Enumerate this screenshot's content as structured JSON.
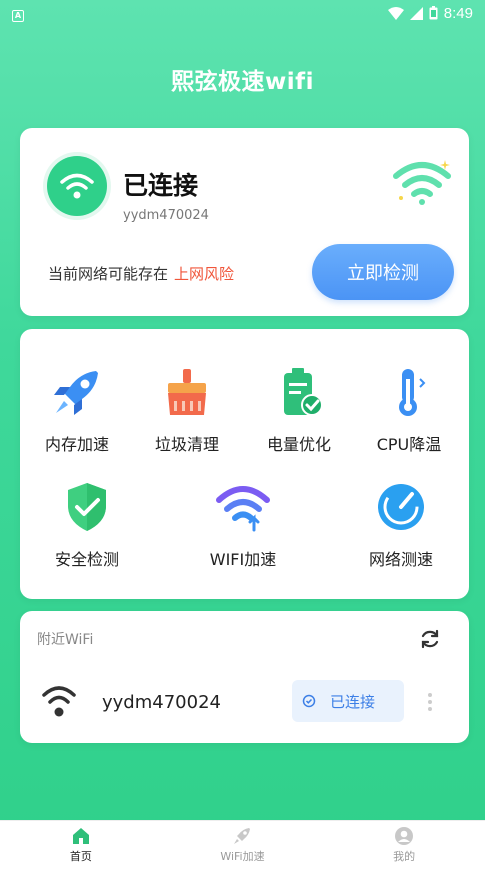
{
  "status_bar": {
    "time": "8:49"
  },
  "app": {
    "title": "熙弦极速wifi"
  },
  "connection": {
    "status": "已连接",
    "ssid": "yydm470024",
    "risk_prefix": "当前网络可能存在",
    "risk_label": "上网风险",
    "check_button": "立即检测"
  },
  "tools": [
    {
      "label": "内存加速",
      "icon": "rocket-icon"
    },
    {
      "label": "垃圾清理",
      "icon": "broom-icon"
    },
    {
      "label": "电量优化",
      "icon": "battery-icon"
    },
    {
      "label": "CPU降温",
      "icon": "thermometer-icon"
    },
    {
      "label": "安全检测",
      "icon": "shield-icon"
    },
    {
      "label": "WIFI加速",
      "icon": "wifi-boost-icon"
    },
    {
      "label": "网络测速",
      "icon": "speedometer-icon"
    }
  ],
  "nearby": {
    "title": "附近WiFi",
    "networks": [
      {
        "ssid": "yydm470024",
        "status": "已连接"
      }
    ]
  },
  "bottom_nav": [
    {
      "label": "首页",
      "icon": "home-icon",
      "active": true
    },
    {
      "label": "WiFi加速",
      "icon": "rocket-icon",
      "active": false
    },
    {
      "label": "我的",
      "icon": "user-icon",
      "active": false
    }
  ],
  "colors": {
    "primary_green": "#2fd08a",
    "accent_blue": "#4b94f5",
    "risk_red": "#f0563b"
  }
}
